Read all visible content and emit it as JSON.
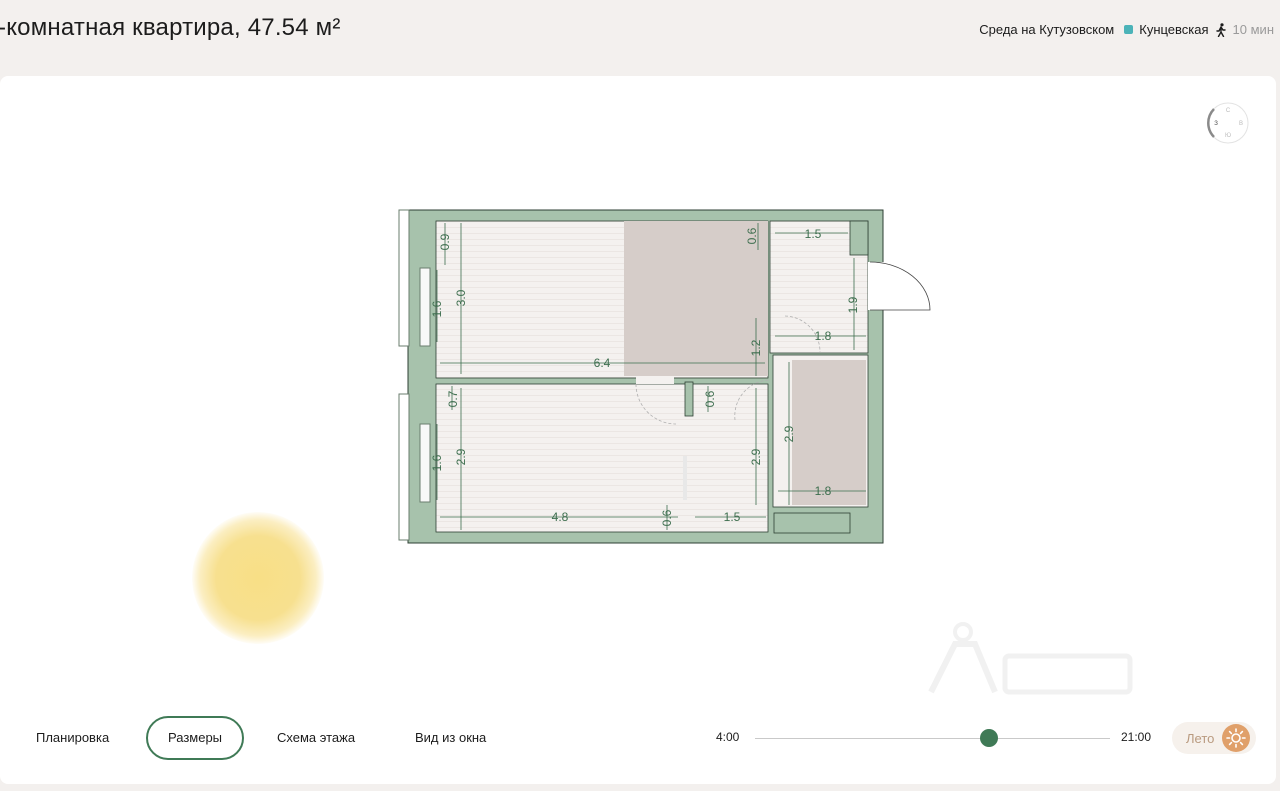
{
  "header": {
    "title": "-комнатная квартира, 47.54 м²",
    "complex_name": "Среда на Кутузовском",
    "metro_station": "Кунцевская",
    "walk_time": "10 мин",
    "metro_color": "#4bb3b8"
  },
  "compass": {
    "north": "С",
    "west": "З",
    "east": "В",
    "south": "Ю"
  },
  "plan": {
    "dimensions": {
      "top_height_left": "0.9",
      "room1_height": "3.0",
      "window1_width": "1.6",
      "room1_length": "6.4",
      "top_niche": "0.6",
      "hall_width": "1.5",
      "hall_height": "1.9",
      "hall_bottom": "1.8",
      "hall_step": "1.2",
      "corridor_gap": "0.7",
      "door_gap": "0.6",
      "room2_height": "2.9",
      "window2_width": "1.6",
      "room2_inner_height": "2.9",
      "bath_height": "2.9",
      "bath_width": "1.8",
      "room2_length": "4.8",
      "bottom_gap": "0.6",
      "bottom_right": "1.5"
    },
    "wall_color": "#a7c2ac",
    "floor_color": "#f4f1ef",
    "furniture_color": "#d6cdc9"
  },
  "tabs": [
    {
      "label": "Планировка",
      "active": false
    },
    {
      "label": "Размеры",
      "active": true
    },
    {
      "label": "Схема этажа",
      "active": false
    },
    {
      "label": "Вид из окна",
      "active": false
    }
  ],
  "sun_slider": {
    "start": "4:00",
    "end": "21:00",
    "position_fraction": 0.66
  },
  "season": {
    "label": "Лето",
    "icon": "sun-icon"
  },
  "accent_color": "#3f7a56"
}
